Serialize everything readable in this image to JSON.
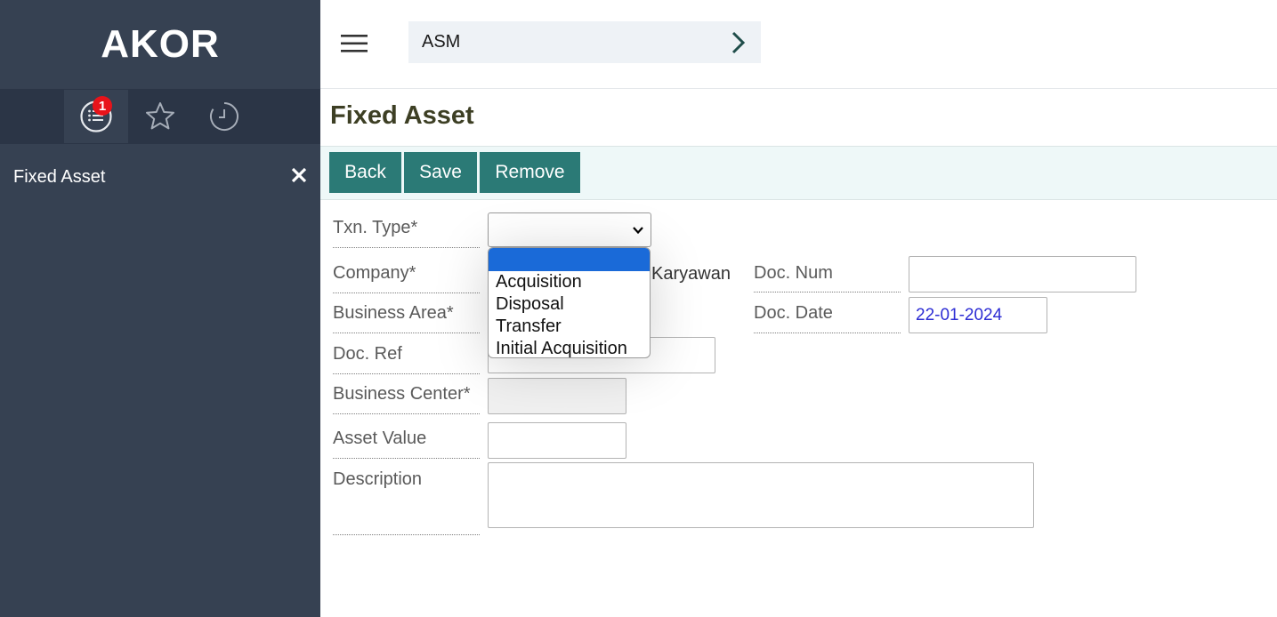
{
  "app": {
    "logo": "AKOR"
  },
  "sidebar": {
    "tabs": [
      {
        "icon": "list-icon",
        "badge": "1",
        "active": true
      },
      {
        "icon": "star-icon",
        "active": false
      },
      {
        "icon": "history-icon",
        "active": false
      }
    ],
    "open_item": {
      "label": "Fixed Asset",
      "close_icon": "close-icon"
    }
  },
  "header": {
    "breadcrumb": {
      "label": "ASM",
      "icon": "chevron-right-icon"
    }
  },
  "page": {
    "title": "Fixed Asset",
    "toolbar": {
      "back_label": "Back",
      "save_label": "Save",
      "remove_label": "Remove"
    },
    "form": {
      "txn_type": {
        "label": "Txn. Type*",
        "value": "",
        "options": [
          "",
          "Acquisition",
          "Disposal",
          "Transfer",
          "Initial Acquisition"
        ],
        "dropdown_open": true
      },
      "company": {
        "label": "Company*",
        "value_visible": "si Karyawan"
      },
      "business_area": {
        "label": "Business Area*"
      },
      "doc_ref": {
        "label": "Doc. Ref",
        "value": ""
      },
      "business_center": {
        "label": "Business Center*",
        "value": ""
      },
      "asset_value": {
        "label": "Asset Value",
        "value": ""
      },
      "description": {
        "label": "Description",
        "value": ""
      },
      "doc_num": {
        "label": "Doc. Num",
        "value": ""
      },
      "doc_date": {
        "label": "Doc. Date",
        "value": "22-01-2024"
      }
    }
  },
  "colors": {
    "sidebar_bg": "#364152",
    "button_bg": "#2b7a76",
    "badge_bg": "#e8131a",
    "option_highlight": "#1a6ad8"
  }
}
